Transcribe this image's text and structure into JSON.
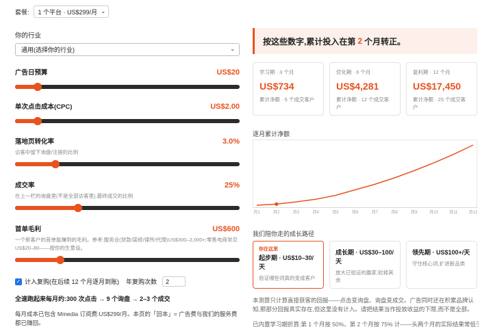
{
  "plan": {
    "label": "套餐:",
    "selected": "1 个平台 · US$299/月"
  },
  "industry": {
    "label": "你的行业",
    "selected": "通用(选择你的行业)"
  },
  "sliders": [
    {
      "title": "广告日预算",
      "value": "US$20",
      "sub": "",
      "fraction": 0.1
    },
    {
      "title": "单次点击成本(CPC)",
      "value": "US$2.00",
      "sub": "",
      "fraction": 0.1
    },
    {
      "title": "落地页转化率",
      "value": "3.0%",
      "sub": "访客中留下询盘/注册的比例",
      "fraction": 0.18
    },
    {
      "title": "成交率",
      "value": "25%",
      "sub": "在上一栏的询盘里(不是全部访客里),最终成交的比例",
      "fraction": 0.28
    },
    {
      "title": "首单毛利",
      "value": "US$600",
      "sub": "一个新客户的首单能赚到的毛利。参考:服务业(贷款/装修/律所/代理)US$300–2,000+;零售电商常见 US$20–80——按你的生意设。",
      "fraction": 0.2
    }
  ],
  "repurchase": {
    "label": "计入复购(在后续 12 个月逐月到账)",
    "count_label": "年复购次数",
    "count_value": "2"
  },
  "fastest": "全速跑起来每月约:300 次点击 → 9 个询盘 → 2–3 个成交",
  "note": "每月成本已包含 Mmedia 订阅费:US$299/月。本页的「回本」= 广告费与我们的服务费都已赚回。",
  "banner": {
    "prefix": "按这些数字,累计投入在第",
    "month": "2",
    "suffix": "个月转正。"
  },
  "cards": [
    {
      "label": "学习期 · 3 个月",
      "value": "US$734",
      "sub": "累计净额 · 5 个成交客户"
    },
    {
      "label": "优化期 · 6 个月",
      "value": "US$4,281",
      "sub": "累计净额 · 12 个成交客户"
    },
    {
      "label": "复利期 · 12 个月",
      "value": "US$17,450",
      "sub": "累计净额 · 25 个成交客户"
    }
  ],
  "chart_title": "逐月累计净额",
  "chart_data": {
    "type": "line",
    "x": [
      "月1",
      "月2",
      "月3",
      "月4",
      "月5",
      "月6",
      "月7",
      "月8",
      "月9",
      "月10",
      "月11",
      "月12"
    ],
    "series": [
      {
        "values": [
          -250,
          80,
          734,
          1500,
          2650,
          4281,
          5900,
          7800,
          9900,
          12200,
          14700,
          17450
        ]
      }
    ],
    "marker_index": 1,
    "color": "#e8521e"
  },
  "path_title": "我们陪你走的成长路径",
  "stages": [
    {
      "tag": "你在这里",
      "title": "起步期 · US$10–30/天",
      "desc": "验证哪些词真的变成客户"
    },
    {
      "tag": "",
      "title": "成长期 · US$30–100/天",
      "desc": "放大已验证的赢家,砍掉其余"
    },
    {
      "tag": "",
      "title": "领先期 · US$100+/天",
      "desc": "守住核心词,扩进新品类"
    }
  ],
  "para1": "本测算只计算直接获客的回报——点击变询盘、询盘变成交。广告同时还在积累品牌认知,那部分回报真实存在,但这里没有计入。请把结果当作投放收益的下限,而不是全部。",
  "para2": "已内置学习期折算:第 1 个月按 50%、第 2 个月按 75% 计——头两个月的实际结果常低于直"
}
